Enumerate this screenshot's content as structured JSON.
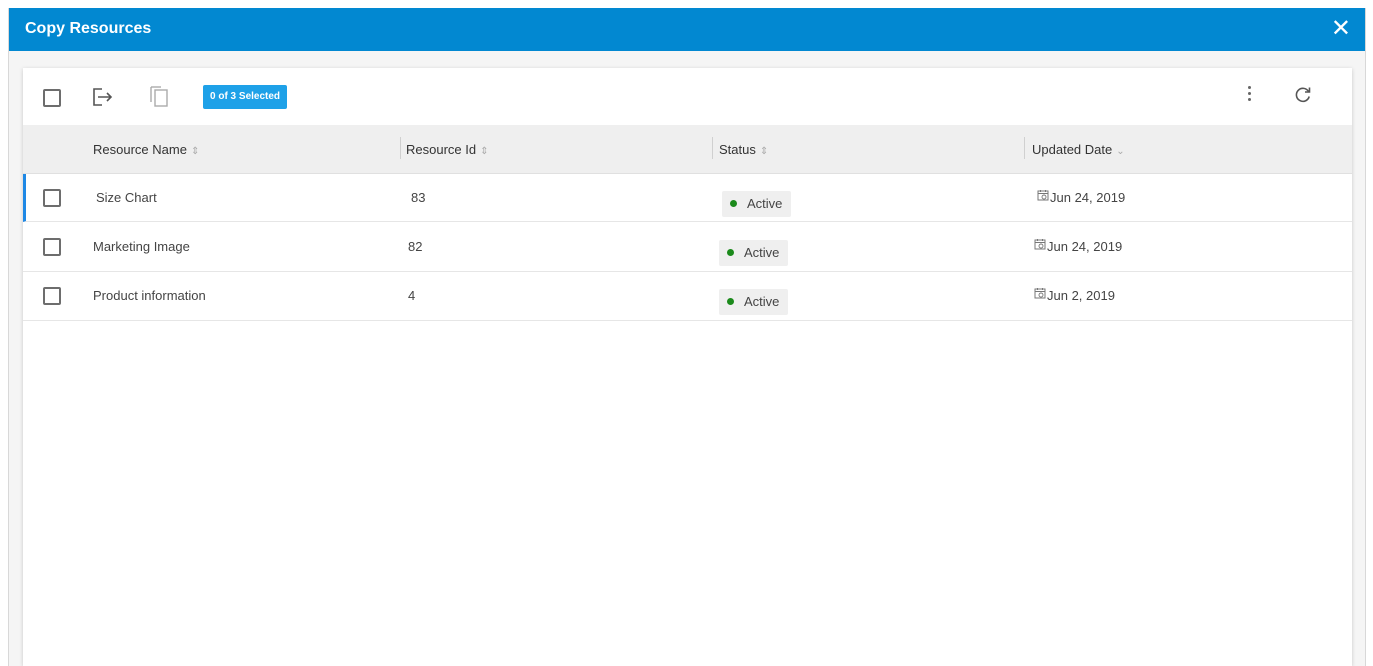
{
  "dialog": {
    "title": "Copy Resources",
    "close_label": "✕"
  },
  "toolbar": {
    "selection_badge": "0 of 3 Selected"
  },
  "columns": [
    {
      "label": "Resource Name",
      "sort": "⇕"
    },
    {
      "label": "Resource Id",
      "sort": "⇕"
    },
    {
      "label": "Status",
      "sort": "⇕"
    },
    {
      "label": "Updated Date",
      "sort": "⌄"
    }
  ],
  "rows": [
    {
      "name": "Size Chart",
      "id": "83",
      "status": "Active",
      "date": "Jun 24, 2019"
    },
    {
      "name": "Marketing Image",
      "id": "82",
      "status": "Active",
      "date": "Jun 24, 2019"
    },
    {
      "name": "Product information",
      "id": "4",
      "status": "Active",
      "date": "Jun 2, 2019"
    }
  ],
  "colors": {
    "titlebar": "#0288d1",
    "badge": "#1ea1e8",
    "active_dot": "#1b8a1b",
    "row_highlight": "#1e88e5"
  },
  "icons": [
    "close-icon",
    "select-all-checkbox",
    "export-icon",
    "copy-icon",
    "more-vert-icon",
    "refresh-icon",
    "calendar-icon"
  ]
}
